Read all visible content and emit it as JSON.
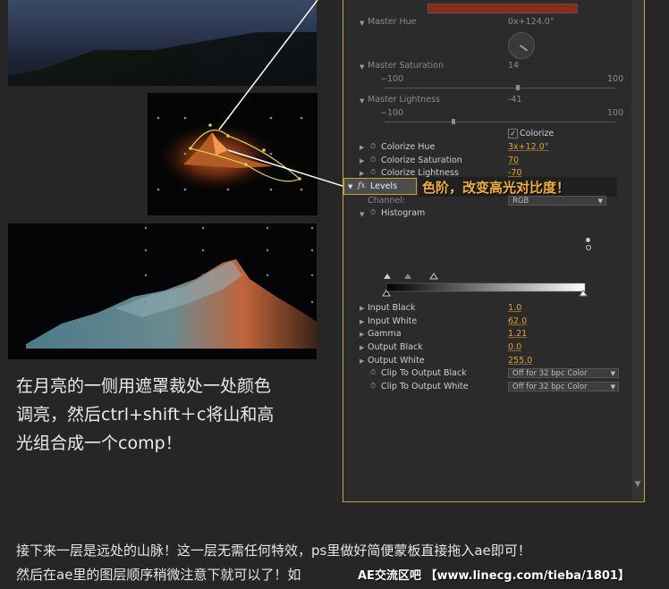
{
  "panel": {
    "master_hue_label": "Master Hue",
    "master_hue_value": "0x+124.0°",
    "master_saturation_label": "Master Saturation",
    "master_saturation_value": "14",
    "sat_min": "−100",
    "sat_max": "100",
    "master_lightness_label": "Master Lightness",
    "master_lightness_value": "-41",
    "light_min": "−100",
    "light_max": "100",
    "colorize_label": "Colorize",
    "colorize_checked": "✓",
    "colorize_hue_label": "Colorize Hue",
    "colorize_hue_value": "3x+12.0°",
    "colorize_saturation_label": "Colorize Saturation",
    "colorize_saturation_value": "70",
    "colorize_lightness_label": "Colorize Lightness",
    "colorize_lightness_value": "-70",
    "fx_label": "fx",
    "levels_label": "Levels",
    "channel_label": "Channel:",
    "channel_value": "RGB",
    "histogram_label": "Histogram",
    "input_black_label": "Input Black",
    "input_black_value": "1.0",
    "input_white_label": "Input White",
    "input_white_value": "62.0",
    "gamma_label": "Gamma",
    "gamma_value": "1.21",
    "output_black_label": "Output Black",
    "output_black_value": "0.0",
    "output_white_label": "Output White",
    "output_white_value": "255.0",
    "clip_black_label": "Clip To Output Black",
    "clip_black_value": "Off for 32 bpc Color",
    "clip_white_label": "Clip To Output White",
    "clip_white_value": "Off for 32 bpc Color"
  },
  "callout": "色阶，改变高光对比度！",
  "caption_lines": [
    "在月亮的一侧用遮罩裁处一处颜色",
    "调亮，然后ctrl+shift＋c将山和高",
    "光组合成一个comp！"
  ],
  "footer_lines": [
    "接下来一层是远处的山脉！这一层无需任何特效，ps里做好简便蒙板直接拖入ae即可！",
    "然后在ae里的图层顺序稍微注意下就可以了！如"
  ],
  "watermark": "AE交流区吧 【www.linecg.com/tieba/1801】",
  "colors": {
    "accent": "#e2a33a",
    "panel_border": "#c9a23a",
    "callout": "#f4b230",
    "hue_bar": "#8e2a18"
  }
}
